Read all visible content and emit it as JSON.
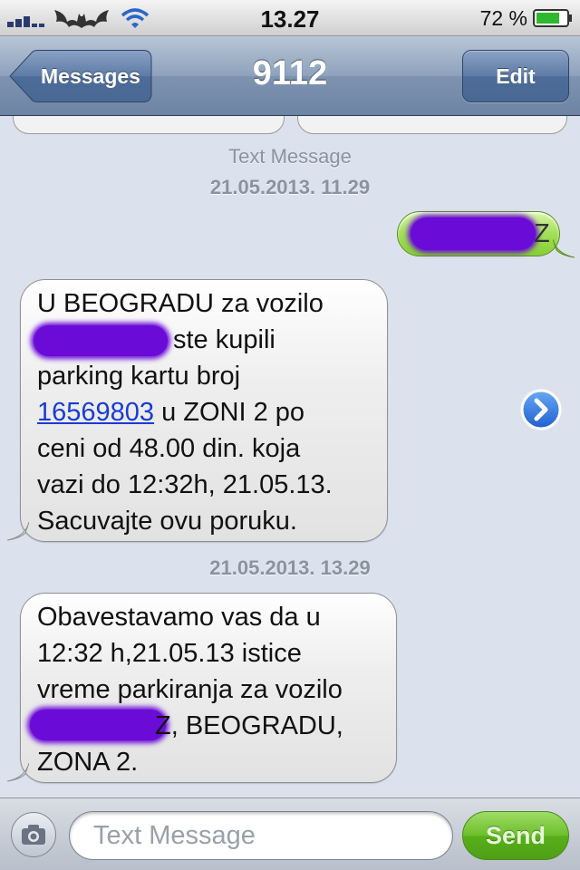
{
  "status_bar": {
    "time": "13.27",
    "battery_percent": "72 %",
    "icons": [
      "signal-bars-icon",
      "bat-logo-icon",
      "wifi-icon",
      "battery-icon"
    ]
  },
  "navbar": {
    "back_label": "Messages",
    "title": "9112",
    "edit_label": "Edit"
  },
  "conversation": {
    "type_label": "Text Message",
    "timestamps": [
      "21.05.2013. 11.29",
      "21.05.2013. 13.29"
    ],
    "sent_message": {
      "visible_text": "Z",
      "redacted": true
    },
    "messages": [
      {
        "lines": [
          {
            "text": "U BEOGRADU za vozilo"
          },
          {
            "text": "ste kupili",
            "redacted_prefix": true
          },
          {
            "text": "parking kartu broj"
          },
          {
            "link": "16569803",
            "text": " u ZONI 2 po"
          },
          {
            "text": "ceni od 48.00 din. koja"
          },
          {
            "text": "vazi do 12:32h, 21.05.13."
          },
          {
            "text": "Sacuvajte ovu poruku."
          }
        ]
      },
      {
        "lines": [
          {
            "text": "Obavestavamo vas da u"
          },
          {
            "text": "12:32 h,21.05.13 istice"
          },
          {
            "text": "vreme parkiranja za vozilo"
          },
          {
            "text": "Z, BEOGRADU,",
            "redacted_prefix": true
          },
          {
            "text": "ZONA 2."
          }
        ]
      }
    ]
  },
  "input_bar": {
    "placeholder": "Text Message",
    "value": "",
    "send_label": "Send"
  },
  "colors": {
    "background": "#dbe2ed",
    "sent_bubble": "#8fd43c",
    "received_bubble": "#e8e8e8",
    "link": "#1a3bd3",
    "redaction": "#6a0bd8",
    "send_button": "#5cb21e"
  }
}
